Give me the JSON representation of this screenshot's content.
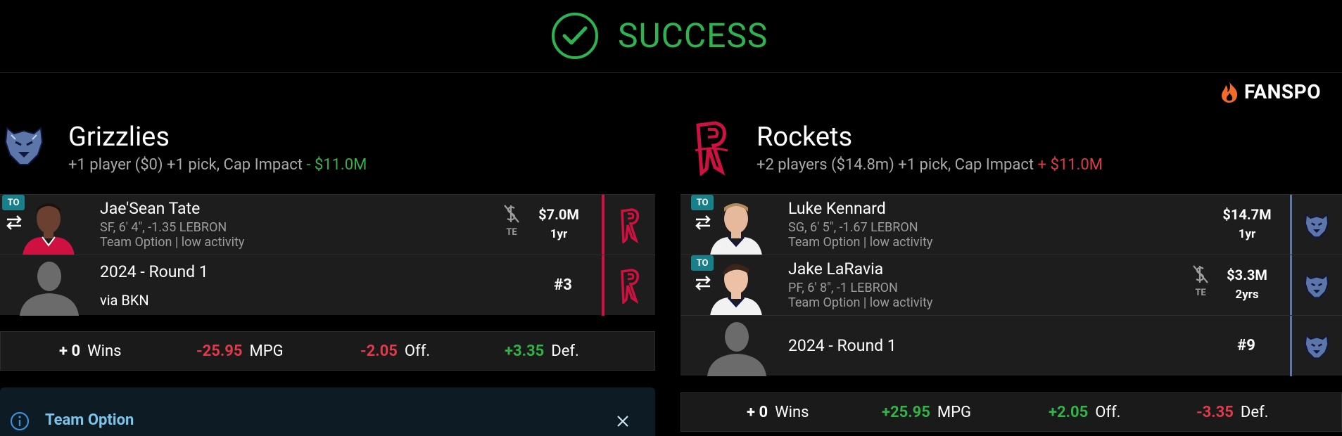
{
  "banner": {
    "status": "SUCCESS",
    "icon": "check-circle-icon"
  },
  "brand": {
    "name": "FANSPO",
    "icon": "flame-icon"
  },
  "teams": [
    {
      "name": "Grizzlies",
      "summary_prefix": "+1 player ($0) +1 pick, Cap Impact",
      "cap_impact": "- $11.0M",
      "cap_impact_color": "#33b248",
      "assets": [
        {
          "badge": "TO",
          "name": "Jae'Sean Tate",
          "meta": "SF, 6' 4\", -1.35 LEBRON",
          "option": "Team Option | low activity",
          "salary": "$7.0M",
          "years": "1yr",
          "te": "TE",
          "from_team": "rockets"
        },
        {
          "name": "2024 - Round 1",
          "via": "via BKN",
          "pick": "#3",
          "from_team": "rockets"
        }
      ],
      "stats": {
        "wins_value": "+ 0",
        "wins_label": "Wins",
        "mpg_value": "-25.95",
        "mpg_label": "MPG",
        "off_value": "-2.05",
        "off_label": "Off.",
        "def_value": "+3.35",
        "def_label": "Def."
      }
    },
    {
      "name": "Rockets",
      "summary_prefix": "+2 players ($14.8m) +1 pick, Cap Impact",
      "cap_impact": "+ $11.0M",
      "cap_impact_color": "#e03a4b",
      "assets": [
        {
          "badge": "TO",
          "name": "Luke Kennard",
          "meta": "SG, 6' 5\", -1.67 LEBRON",
          "option": "Team Option | low activity",
          "salary": "$14.7M",
          "years": "1yr",
          "from_team": "grizzlies"
        },
        {
          "badge": "TO",
          "name": "Jake LaRavia",
          "meta": "PF, 6' 8\", -1 LEBRON",
          "option": "Team Option | low activity",
          "salary": "$3.3M",
          "years": "2yrs",
          "te": "TE",
          "from_team": "grizzlies"
        },
        {
          "name": "2024 - Round 1",
          "pick": "#9",
          "from_team": "grizzlies"
        }
      ],
      "stats": {
        "wins_value": "+ 0",
        "wins_label": "Wins",
        "mpg_value": "+25.95",
        "mpg_label": "MPG",
        "off_value": "+2.05",
        "off_label": "Off.",
        "def_value": "-3.35",
        "def_label": "Def."
      }
    }
  ],
  "info": {
    "title": "Team Option",
    "icon": "info-icon",
    "close_icon": "close-icon"
  },
  "colors": {
    "success": "#2fb34f",
    "rockets_red": "#ce1141",
    "grizzlies_blue": "#5d76a9",
    "option_teal": "#17808a"
  }
}
